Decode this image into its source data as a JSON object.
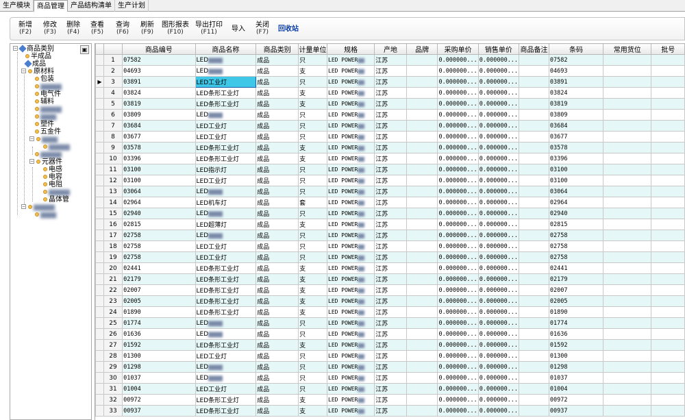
{
  "tabs": [
    "生产模块",
    "商品管理",
    "产品结构清单",
    "生产计划"
  ],
  "active_tab": 1,
  "toolbar": [
    {
      "label": "新增",
      "key": "(F2)"
    },
    {
      "label": "修改",
      "key": "(F3)"
    },
    {
      "label": "删除",
      "key": "(F4)"
    },
    {
      "label": "查看",
      "key": "(F5)"
    },
    {
      "label": "查询",
      "key": "(F6)"
    },
    {
      "label": "刷新",
      "key": "(F9)"
    },
    {
      "label": "图形报表",
      "key": "(F10)"
    },
    {
      "label": "导出打印",
      "key": "(F11)"
    },
    {
      "label": "导入",
      "key": ""
    },
    {
      "label": "关闭",
      "key": "(F7)"
    },
    {
      "label": "回收站",
      "key": ""
    }
  ],
  "tree": {
    "root": "商品类别",
    "nodes": [
      {
        "label": "半成品"
      },
      {
        "label": "成品"
      },
      {
        "label": "原材料"
      },
      {
        "label": "包装"
      },
      {
        "label": "电气件"
      },
      {
        "label": "辅料"
      },
      {
        "label": "塑件"
      },
      {
        "label": "五金件"
      },
      {
        "label": "元器件"
      },
      {
        "label": "电感"
      },
      {
        "label": "电容"
      },
      {
        "label": "电阻"
      },
      {
        "label": "晶体管"
      }
    ]
  },
  "columns": [
    "",
    "",
    "商品编号",
    "商品名称",
    "商品类别",
    "计量单位",
    "规格",
    "产地",
    "品牌",
    "采购单价",
    "销售单价",
    "商品备注",
    "条码",
    "常用货位",
    "批号"
  ],
  "common": {
    "category": "成品",
    "origin": "江苏",
    "price": "0.000000...",
    "spec_prefix": "LED POWER"
  },
  "rows": [
    {
      "no": "1",
      "code": "07582",
      "name": "LED",
      "unit": "只",
      "barcode": "07582"
    },
    {
      "no": "2",
      "code": "04693",
      "name": "LED",
      "unit": "支",
      "barcode": "04693"
    },
    {
      "no": "3",
      "code": "03891",
      "name": "LED工业灯",
      "unit": "只",
      "barcode": "03891"
    },
    {
      "no": "4",
      "code": "03824",
      "name": "LED条形工业灯",
      "unit": "支",
      "barcode": "03824"
    },
    {
      "no": "5",
      "code": "03819",
      "name": "LED条形工业灯",
      "unit": "支",
      "barcode": "03819"
    },
    {
      "no": "6",
      "code": "03809",
      "name": "LED",
      "unit": "只",
      "barcode": "03809"
    },
    {
      "no": "7",
      "code": "03684",
      "name": "LED工业灯",
      "unit": "只",
      "barcode": "03684"
    },
    {
      "no": "8",
      "code": "03677",
      "name": "LED工业灯",
      "unit": "只",
      "barcode": "03677"
    },
    {
      "no": "9",
      "code": "03578",
      "name": "LED条形工业灯",
      "unit": "支",
      "barcode": "03578"
    },
    {
      "no": "10",
      "code": "03396",
      "name": "LED条形工业灯",
      "unit": "支",
      "barcode": "03396"
    },
    {
      "no": "11",
      "code": "03100",
      "name": "LED指示灯",
      "unit": "只",
      "barcode": "03100"
    },
    {
      "no": "12",
      "code": "03100",
      "name": "LED工业灯",
      "unit": "只",
      "barcode": "03100"
    },
    {
      "no": "13",
      "code": "03064",
      "name": "LED",
      "unit": "只",
      "barcode": "03064"
    },
    {
      "no": "14",
      "code": "02964",
      "name": "LED机车灯",
      "unit": "套",
      "barcode": "02964"
    },
    {
      "no": "15",
      "code": "02940",
      "name": "LED",
      "unit": "只",
      "barcode": "02940"
    },
    {
      "no": "16",
      "code": "02815",
      "name": "LED超薄灯",
      "unit": "支",
      "barcode": "02815"
    },
    {
      "no": "17",
      "code": "02758",
      "name": "LED",
      "unit": "只",
      "barcode": "02758"
    },
    {
      "no": "18",
      "code": "02758",
      "name": "LED工业灯",
      "unit": "只",
      "barcode": "02758"
    },
    {
      "no": "19",
      "code": "02758",
      "name": "LED工业灯",
      "unit": "只",
      "barcode": "02758"
    },
    {
      "no": "20",
      "code": "02441",
      "name": "LED条形工业灯",
      "unit": "支",
      "barcode": "02441"
    },
    {
      "no": "21",
      "code": "02179",
      "name": "LED条形工业灯",
      "unit": "支",
      "barcode": "02179"
    },
    {
      "no": "22",
      "code": "02007",
      "name": "LED条形工业灯",
      "unit": "支",
      "barcode": "02007"
    },
    {
      "no": "23",
      "code": "02005",
      "name": "LED条形工业灯",
      "unit": "支",
      "barcode": "02005"
    },
    {
      "no": "24",
      "code": "01890",
      "name": "LED条形工业灯",
      "unit": "支",
      "barcode": "01890"
    },
    {
      "no": "25",
      "code": "01774",
      "name": "LED",
      "unit": "只",
      "barcode": "01774"
    },
    {
      "no": "26",
      "code": "01636",
      "name": "LED",
      "unit": "只",
      "barcode": "01636"
    },
    {
      "no": "27",
      "code": "01592",
      "name": "LED条形工业灯",
      "unit": "支",
      "barcode": "01592"
    },
    {
      "no": "28",
      "code": "01300",
      "name": "LED工业灯",
      "unit": "只",
      "barcode": "01300"
    },
    {
      "no": "29",
      "code": "01298",
      "name": "LED",
      "unit": "只",
      "barcode": "01298"
    },
    {
      "no": "30",
      "code": "01037",
      "name": "LED",
      "unit": "只",
      "barcode": "01037"
    },
    {
      "no": "31",
      "code": "01004",
      "name": "LED工业灯",
      "unit": "只",
      "barcode": "01004"
    },
    {
      "no": "32",
      "code": "00972",
      "name": "LED条形工业灯",
      "unit": "支",
      "barcode": "00972"
    },
    {
      "no": "33",
      "code": "00937",
      "name": "LED条形工业灯",
      "unit": "支",
      "barcode": "00937"
    }
  ],
  "selected_row": 2
}
